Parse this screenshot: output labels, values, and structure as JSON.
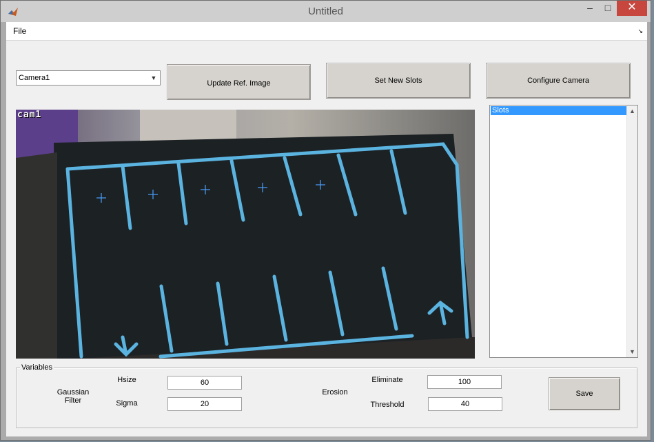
{
  "window": {
    "title": "Untitled",
    "minimize": "–",
    "maximize": "□",
    "close": "✕"
  },
  "menu": {
    "file": "File",
    "corner_arrow": "↘"
  },
  "camera_select": {
    "value": "Camera1",
    "arrow": "▼"
  },
  "buttons": {
    "update_ref": "Update Ref. Image",
    "set_slots": "Set New Slots",
    "configure_camera": "Configure Camera",
    "save": "Save"
  },
  "camera_view": {
    "overlay_label": "cam1"
  },
  "slots_list": {
    "items": [
      "Slots"
    ],
    "scroll_up": "▲",
    "scroll_down": "▼"
  },
  "variables": {
    "title": "Variables",
    "gaussian_label": "Gaussian Filter",
    "hsize_label": "Hsize",
    "hsize_value": "60",
    "sigma_label": "Sigma",
    "sigma_value": "20",
    "erosion_label": "Erosion",
    "eliminate_label": "Eliminate",
    "eliminate_value": "100",
    "threshold_label": "Threshold",
    "threshold_value": "40"
  },
  "colors": {
    "tape": "#5bb3e0",
    "board": "#1c2124",
    "selection": "#3399ff",
    "close_button": "#c7473f"
  }
}
